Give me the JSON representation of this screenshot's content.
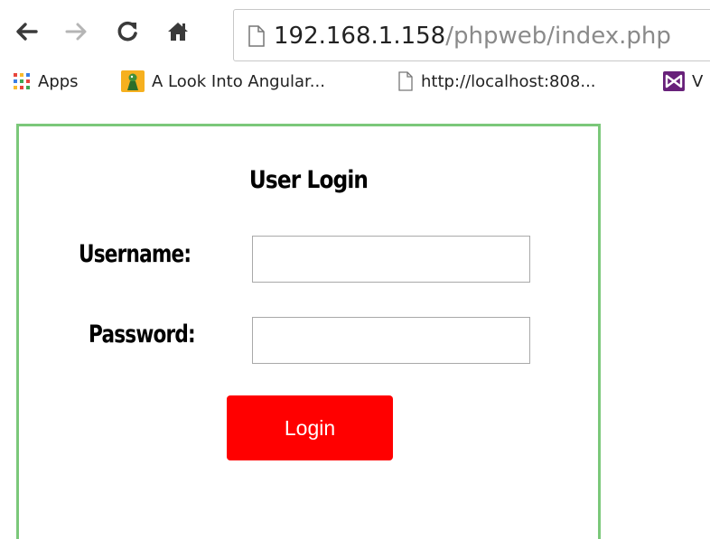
{
  "browser": {
    "url_host": "192.168.1.158",
    "url_path": "/phpweb/index.php"
  },
  "bookmarks": [
    {
      "label": "Apps",
      "icon": "apps-grid-icon"
    },
    {
      "label": "A Look Into Angular...",
      "icon": "angular-bookmark-icon"
    },
    {
      "label": "http://localhost:808...",
      "icon": "page-icon"
    },
    {
      "label": "V",
      "icon": "visual-studio-icon"
    }
  ],
  "login": {
    "title": "User Login",
    "username_label": "Username:",
    "username_value": "",
    "password_label": "Password:",
    "password_value": "",
    "submit_label": "Login"
  },
  "colors": {
    "box_border": "#7bc87a",
    "button_bg": "#ff0000",
    "button_text": "#ffffff"
  }
}
